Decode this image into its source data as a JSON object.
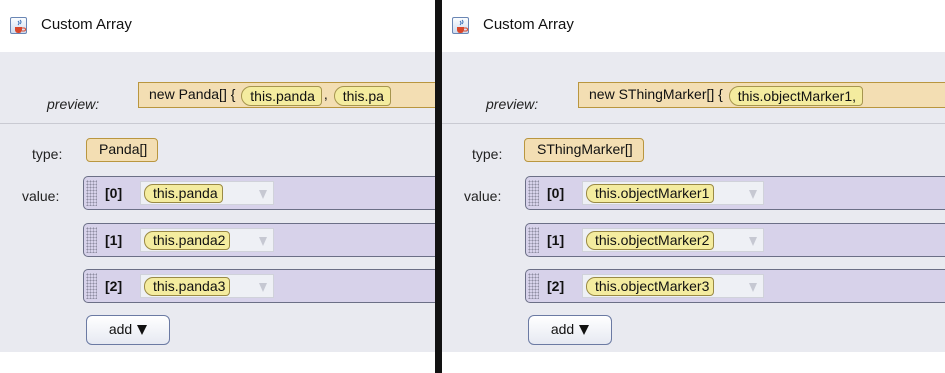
{
  "panels": [
    {
      "title": "Custom Array",
      "preview_label": "preview:",
      "preview_prefix": "new Panda[] {",
      "preview_items": [
        "this.panda",
        "this.pa"
      ],
      "type_label": "type:",
      "type_value": "Panda[]",
      "value_label": "value:",
      "items": [
        {
          "index": "[0]",
          "value": "this.panda"
        },
        {
          "index": "[1]",
          "value": "this.panda2"
        },
        {
          "index": "[2]",
          "value": "this.panda3"
        }
      ],
      "add_label": "add"
    },
    {
      "title": "Custom Array",
      "preview_label": "preview:",
      "preview_prefix": "new SThingMarker[] {",
      "preview_items": [
        "this.objectMarker1,"
      ],
      "type_label": "type:",
      "type_value": "SThingMarker[]",
      "value_label": "value:",
      "items": [
        {
          "index": "[0]",
          "value": "this.objectMarker1"
        },
        {
          "index": "[1]",
          "value": "this.objectMarker2"
        },
        {
          "index": "[2]",
          "value": "this.objectMarker3"
        }
      ],
      "add_label": "add"
    }
  ],
  "icons": {
    "title_icon": "java-cup-icon",
    "add_dropdown": "triangle-down-icon"
  },
  "colors": {
    "content_bg": "#e9eaf0",
    "type_chip": "#f3deb3",
    "value_chip": "#f4ec9f",
    "item_row": "#d7d2ea",
    "divider": "#121212"
  }
}
